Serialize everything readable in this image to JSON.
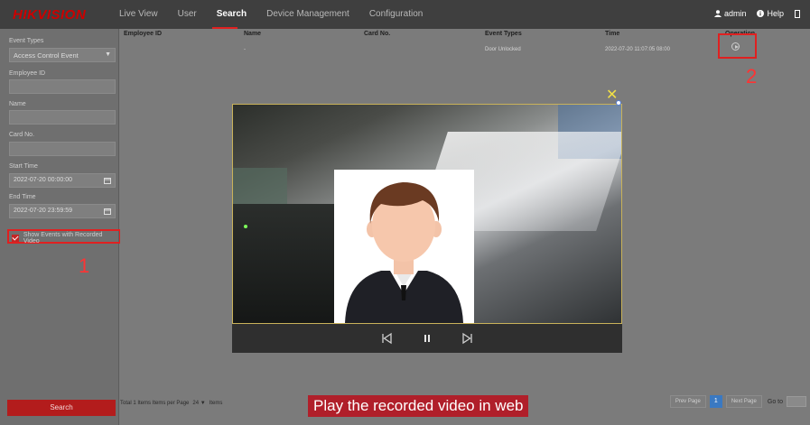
{
  "header": {
    "logo": "HIKVISION",
    "nav": [
      "Live View",
      "User",
      "Search",
      "Device Management",
      "Configuration"
    ],
    "active_nav": "Search",
    "user_label": "admin",
    "help_label": "Help",
    "accent_color": "#e02020"
  },
  "sidebar": {
    "event_types_label": "Event Types",
    "event_types_value": "Access Control Event",
    "employee_id_label": "Employee ID",
    "name_label": "Name",
    "card_no_label": "Card No.",
    "start_time_label": "Start Time",
    "start_time_value": "2022-07-20 00:00:00",
    "end_time_label": "End Time",
    "end_time_value": "2022-07-20 23:59:59",
    "recorded_video_label": "Show Events with Recorded Video",
    "recorded_video_checked": true,
    "marker_1": "1",
    "search_button": "Search"
  },
  "table": {
    "columns": [
      "Employee ID",
      "Name",
      "Card No.",
      "Event Types",
      "Time",
      "Operation"
    ],
    "rows": [
      {
        "employee_id": "",
        "name": "-",
        "card_no": "",
        "event_type": "Door Unlocked",
        "time": "2022-07-20 11:07:05 08:00"
      }
    ],
    "marker_2": "2"
  },
  "footer": {
    "total_text": "Total 1 Items Items per Page",
    "per_page": "24",
    "items_label": "Items",
    "prev_page": "Prev Page",
    "current_page": "1",
    "next_page": "Next Page",
    "goto_label": "Go to"
  },
  "video": {
    "icons": [
      "prev-frame-icon",
      "pause-icon",
      "next-frame-icon",
      "close-icon"
    ]
  },
  "caption": "Play the recorded video in web"
}
